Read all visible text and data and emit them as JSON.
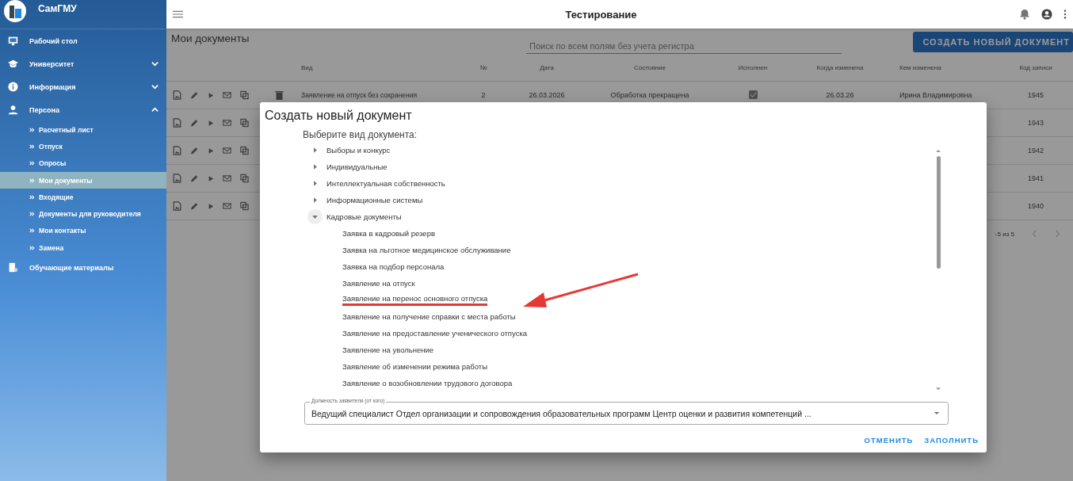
{
  "sidebar": {
    "brand": "СамГМУ",
    "items": [
      {
        "label": "Рабочий стол"
      },
      {
        "label": "Университет",
        "expanded": false
      },
      {
        "label": "Информация",
        "expanded": false
      },
      {
        "label": "Персона",
        "expanded": true,
        "children": [
          {
            "label": "Расчетный лист",
            "selected": false
          },
          {
            "label": "Отпуск",
            "selected": false
          },
          {
            "label": "Опросы",
            "selected": false
          },
          {
            "label": "Мои документы",
            "selected": true
          },
          {
            "label": "Входящие",
            "selected": false
          },
          {
            "label": "Документы для руководителя",
            "selected": false
          },
          {
            "label": "Мои контакты",
            "selected": false
          },
          {
            "label": "Замена",
            "selected": false
          }
        ]
      },
      {
        "label": "Обучающие материалы"
      }
    ]
  },
  "top_bar": {
    "title": "Тестирование"
  },
  "page": {
    "title": "Мои документы",
    "search": {
      "placeholder": "Поиск по всем полям без учета регистра"
    },
    "create_button": "СОЗДАТЬ НОВЫЙ ДОКУМЕНТ"
  },
  "table": {
    "columns": [
      "Вид",
      "№",
      "Дата",
      "Состояние",
      "Исполнен",
      "Когда изменена",
      "Кем изменена",
      "Код записи"
    ],
    "rows": [
      {
        "deletable": true,
        "type": "Заявление на отпуск без сохранения",
        "number": "2",
        "date": "26.03.2026",
        "status": "Обработка прекращена",
        "done": true,
        "changed": "26.03.26",
        "changed_by": "Ирина Владимировна",
        "code": "1945"
      },
      {
        "code": "1943"
      },
      {
        "code": "1942"
      },
      {
        "code": "1941"
      },
      {
        "code": "1940"
      }
    ],
    "pagination": "-5 из 5"
  },
  "dialog": {
    "title": "Создать новый документ",
    "prompt": "Выберите вид документа:",
    "tree": [
      {
        "label": "Выборы и конкурс",
        "expanded": false
      },
      {
        "label": "Индивидуальные",
        "expanded": false
      },
      {
        "label": "Интеллектуальная собственность",
        "expanded": false
      },
      {
        "label": "Информационные системы",
        "expanded": false
      },
      {
        "label": "Кадровые документы",
        "expanded": true,
        "children": [
          {
            "label": "Заявка в кадровый резерв",
            "highlighted": false
          },
          {
            "label": "Заявка на льготное медицинское обслуживание",
            "highlighted": false
          },
          {
            "label": "Заявка на подбор персонала",
            "highlighted": false
          },
          {
            "label": "Заявление на отпуск",
            "highlighted": false
          },
          {
            "label": "Заявление на перенос основного отпуска",
            "highlighted": true
          },
          {
            "label": "Заявление на получение справки с места работы",
            "highlighted": false
          },
          {
            "label": "Заявление на предоставление ученического отпуска",
            "highlighted": false
          },
          {
            "label": "Заявление на увольнение",
            "highlighted": false
          },
          {
            "label": "Заявление об изменении режима работы",
            "highlighted": false
          },
          {
            "label": "Заявление о возобновлении трудового договора",
            "highlighted": false
          }
        ]
      }
    ],
    "select": {
      "label": "Должность заявителя (от кого)",
      "value": "Ведущий специалист Отдел организации и сопровождения образовательных программ Центр оценки и развития компетенций ..."
    },
    "buttons": [
      "ОТМЕНИТЬ",
      "ЗАПОЛНИТЬ"
    ]
  }
}
